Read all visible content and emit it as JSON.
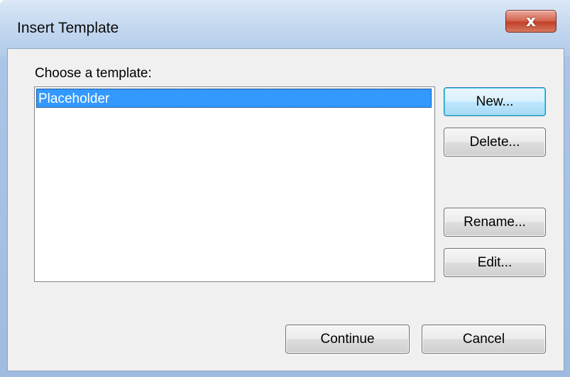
{
  "window": {
    "title": "Insert Template",
    "close_glyph": "x"
  },
  "dialog": {
    "choose_label": "Choose a template:",
    "templates": [
      "Placeholder"
    ],
    "selected_template": "Placeholder"
  },
  "buttons": {
    "new": "New...",
    "delete": "Delete...",
    "rename": "Rename...",
    "edit": "Edit...",
    "continue": "Continue",
    "cancel": "Cancel"
  },
  "colors": {
    "selection": "#3399ff",
    "close_button": "#c2412a"
  }
}
